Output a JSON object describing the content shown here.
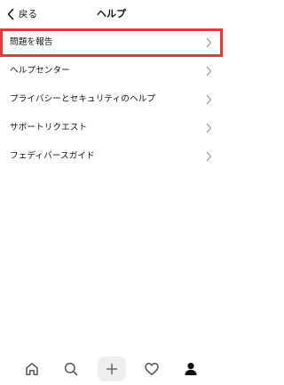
{
  "header": {
    "back_label": "戻る",
    "title": "ヘルプ"
  },
  "menu": {
    "items": [
      {
        "label": "問題を報告",
        "highlighted": true
      },
      {
        "label": "ヘルプセンター"
      },
      {
        "label": "プライバシーとセキュリティのヘルプ"
      },
      {
        "label": "サポートリクエスト"
      },
      {
        "label": "フェディバースガイド"
      }
    ]
  },
  "tabbar": {
    "tabs": [
      "home-icon",
      "search-icon",
      "add-icon",
      "heart-icon",
      "profile-icon"
    ],
    "active": "profile-icon"
  },
  "colors": {
    "highlight_border": "#e23b3b",
    "add_button_bg": "#eeeeee",
    "chevron": "#9a9a9a"
  }
}
